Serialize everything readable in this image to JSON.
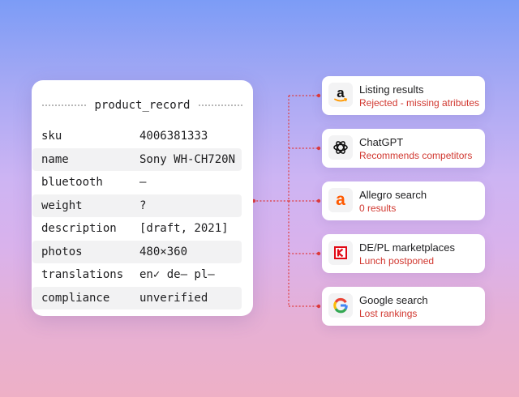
{
  "record": {
    "title": "product_record",
    "fields": [
      {
        "key": "sku",
        "value": "4006381333"
      },
      {
        "key": "name",
        "value": "Sony WH-CH720N"
      },
      {
        "key": "bluetooth",
        "value": "—"
      },
      {
        "key": "weight",
        "value": "?"
      },
      {
        "key": "description",
        "value": "[draft, 2021]"
      },
      {
        "key": "photos",
        "value": "480×360"
      },
      {
        "key": "translations",
        "value": "en✓ de— pl—"
      },
      {
        "key": "compliance",
        "value": "unverified"
      }
    ]
  },
  "channels": [
    {
      "title": "Listing results",
      "status": "Rejected - missing atributes",
      "icon": "amazon-icon"
    },
    {
      "title": "ChatGPT",
      "status": "Recommends competitors",
      "icon": "chatgpt-icon"
    },
    {
      "title": "Allegro search",
      "status": "0 results",
      "icon": "allegro-icon"
    },
    {
      "title": "DE/PL marketplaces",
      "status": "Lunch postponed",
      "icon": "kaufland-icon"
    },
    {
      "title": "Google search",
      "status": "Lost rankings",
      "icon": "google-icon"
    }
  ],
  "colors": {
    "status_red": "#d1372f",
    "connector": "#e03a3a",
    "allegro_orange": "#ff5a00",
    "amazon_orange": "#ff9900",
    "kaufland_red": "#e10915"
  }
}
